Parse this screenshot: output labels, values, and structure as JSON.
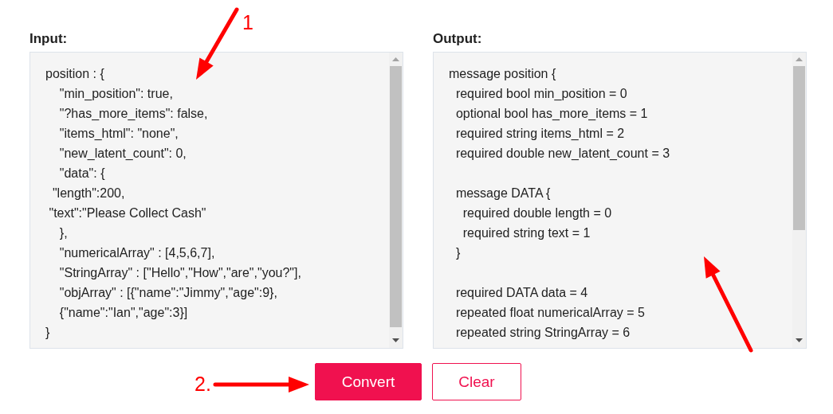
{
  "panels": [
    {
      "label": "Input:",
      "value": "position : {\n    \"min_position\": true,\n    \"?has_more_items\": false,\n    \"items_html\": \"none\",\n    \"new_latent_count\": 0,\n    \"data\": {\n  \"length\":200,\n \"text\":\"Please Collect Cash\"\n    },\n    \"numericalArray\" : [4,5,6,7],\n    \"StringArray\" : [\"Hello\",\"How\",\"are\",\"you?\"],\n    \"objArray\" : [{\"name\":\"Jimmy\",\"age\":9},\n    {\"name\":\"Ian\",\"age\":3}]\n}"
    },
    {
      "label": "Output:",
      "value": "message position {\n  required bool min_position = 0\n  optional bool has_more_items = 1\n  required string items_html = 2\n  required double new_latent_count = 3\n\n  message DATA {\n    required double length = 0\n    required string text = 1\n  }\n\n  required DATA data = 4\n  repeated float numericalArray = 5\n  repeated string StringArray = 6"
    }
  ],
  "buttons": [
    {
      "label": "Convert",
      "kind": "primary"
    },
    {
      "label": "Clear",
      "kind": "outline"
    }
  ],
  "annotations": [
    {
      "label": "1"
    },
    {
      "label": "2."
    }
  ]
}
